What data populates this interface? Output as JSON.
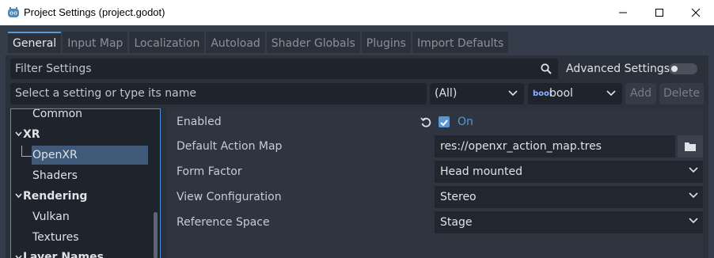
{
  "window": {
    "title": "Project Settings (project.godot)"
  },
  "tabs": [
    "General",
    "Input Map",
    "Localization",
    "Autoload",
    "Shader Globals",
    "Plugins",
    "Import Defaults"
  ],
  "filter": {
    "placeholder": "Filter Settings",
    "advanced_label": "Advanced Settings"
  },
  "add_setting": {
    "placeholder": "Select a setting or type its name",
    "scope": "(All)",
    "type_badge": "bool",
    "type": "bool",
    "add_label": "Add",
    "delete_label": "Delete"
  },
  "tree": [
    {
      "label": "Common",
      "level": 1
    },
    {
      "label": "XR",
      "level": 0
    },
    {
      "label": "OpenXR",
      "level": 1,
      "selected": true
    },
    {
      "label": "Shaders",
      "level": 1
    },
    {
      "label": "Rendering",
      "level": 0
    },
    {
      "label": "Vulkan",
      "level": 1
    },
    {
      "label": "Textures",
      "level": 1
    },
    {
      "label": "Layer Names",
      "level": 0
    }
  ],
  "properties": {
    "enabled": {
      "label": "Enabled",
      "value": "On",
      "checked": true
    },
    "action_map": {
      "label": "Default Action Map",
      "value": "res://openxr_action_map.tres"
    },
    "form_factor": {
      "label": "Form Factor",
      "value": "Head mounted"
    },
    "view_config": {
      "label": "View Configuration",
      "value": "Stereo"
    },
    "ref_space": {
      "label": "Reference Space",
      "value": "Stage"
    }
  },
  "colors": {
    "accent": "#5a97d4",
    "panel": "#2b313b",
    "background": "#363d4a"
  },
  "icons": [
    "godot-icon",
    "minimize-icon",
    "maximize-icon",
    "close-icon",
    "search-icon",
    "toggle-switch",
    "revert-icon",
    "checkbox-icon",
    "folder-icon",
    "chevron-down-icon"
  ]
}
